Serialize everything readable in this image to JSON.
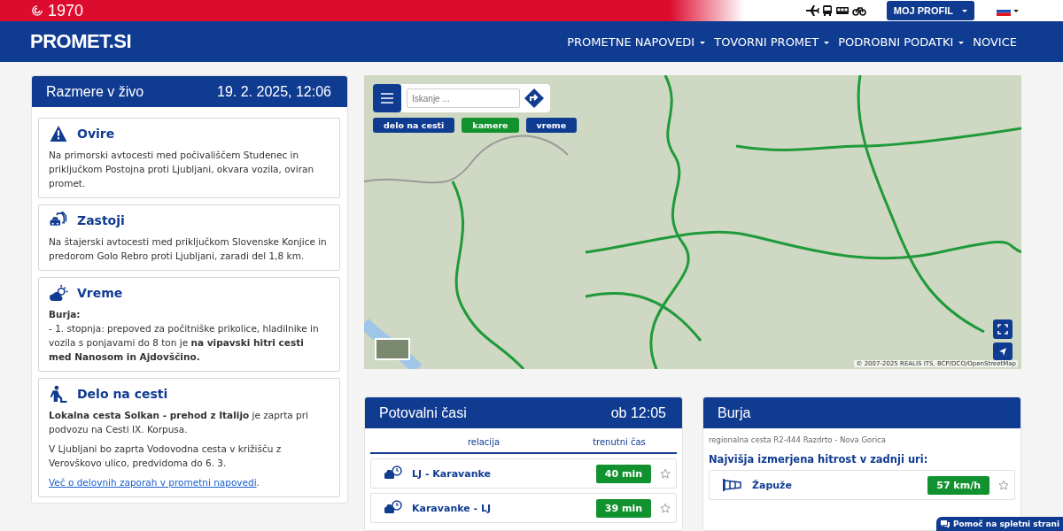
{
  "topbar": {
    "year": "1970",
    "profile_button": "MOJ PROFIL"
  },
  "header": {
    "logo": "PROMET.SI",
    "nav": [
      {
        "label": "PROMETNE NAPOVEDI",
        "dropdown": true
      },
      {
        "label": "TOVORNI PROMET",
        "dropdown": true
      },
      {
        "label": "PODROBNI PODATKI",
        "dropdown": true
      },
      {
        "label": "NOVICE",
        "dropdown": false
      }
    ]
  },
  "live_panel": {
    "title": "Razmere v živo",
    "datetime": "19. 2. 2025, 12:06",
    "sections": [
      {
        "kind": "obstacle",
        "title": "Ovire",
        "paragraphs": [
          "Na primorski avtocesti med počivališčem Studenec in priključkom Postojna proti Ljubljani, okvara vozila, oviran promet."
        ]
      },
      {
        "kind": "congestion",
        "title": "Zastoji",
        "paragraphs": [
          "Na štajerski avtocesti med priključkom Slovenske Konjice in predorom Golo Rebro proti Ljubljani, zaradi del 1,8 km."
        ]
      },
      {
        "kind": "weather",
        "title": "Vreme",
        "paragraphs": [
          "**Burja:**",
          "- 1. stopnja: prepoved za počitniške prikolice, hladilnike in vozila s ponjavami do 8 ton je **na vipavski hitri cesti med Nanosom in Ajdovščino.**"
        ]
      },
      {
        "kind": "roadworks",
        "title": "Delo na cesti",
        "paragraphs": [
          "**Lokalna cesta Solkan - prehod z Italijo** je zaprta pri podvozu na Cesti IX. Korpusa.",
          "V Ljubljani bo zaprta Vodovodna cesta v križišču z Verovškovo ulico, predvidoma do 6. 3."
        ],
        "link": "Več o delovnih zaporah v prometni napovedi",
        "link_suffix": "."
      }
    ]
  },
  "map": {
    "search": {
      "placeholder": "Iskanje ..."
    },
    "filters": [
      {
        "label": "delo na cesti",
        "selected": false
      },
      {
        "label": "kamere",
        "selected": true
      },
      {
        "label": "vreme",
        "selected": false
      }
    ],
    "attribution": "© 2007-2025 REALIS ITS, BCP/DCO/OpenStreetMap"
  },
  "travel_times": {
    "title": "Potovalni časi",
    "time": "ob 12:05",
    "columns": [
      "relacija",
      "trenutni čas"
    ],
    "rows": [
      {
        "route": "LJ - Karavanke",
        "duration": "40 min"
      },
      {
        "route": "Karavanke - LJ",
        "duration": "39 min"
      }
    ]
  },
  "wind": {
    "title": "Burja",
    "road": "regionalna cesta R2-444 Razdrto - Nova Gorica",
    "subtitle": "Najvišja izmerjena hitrost v zadnji uri:",
    "rows": [
      {
        "place": "Žapuže",
        "speed": "57 km/h"
      }
    ]
  },
  "help_chip": "Pomoč na spletni strani"
}
